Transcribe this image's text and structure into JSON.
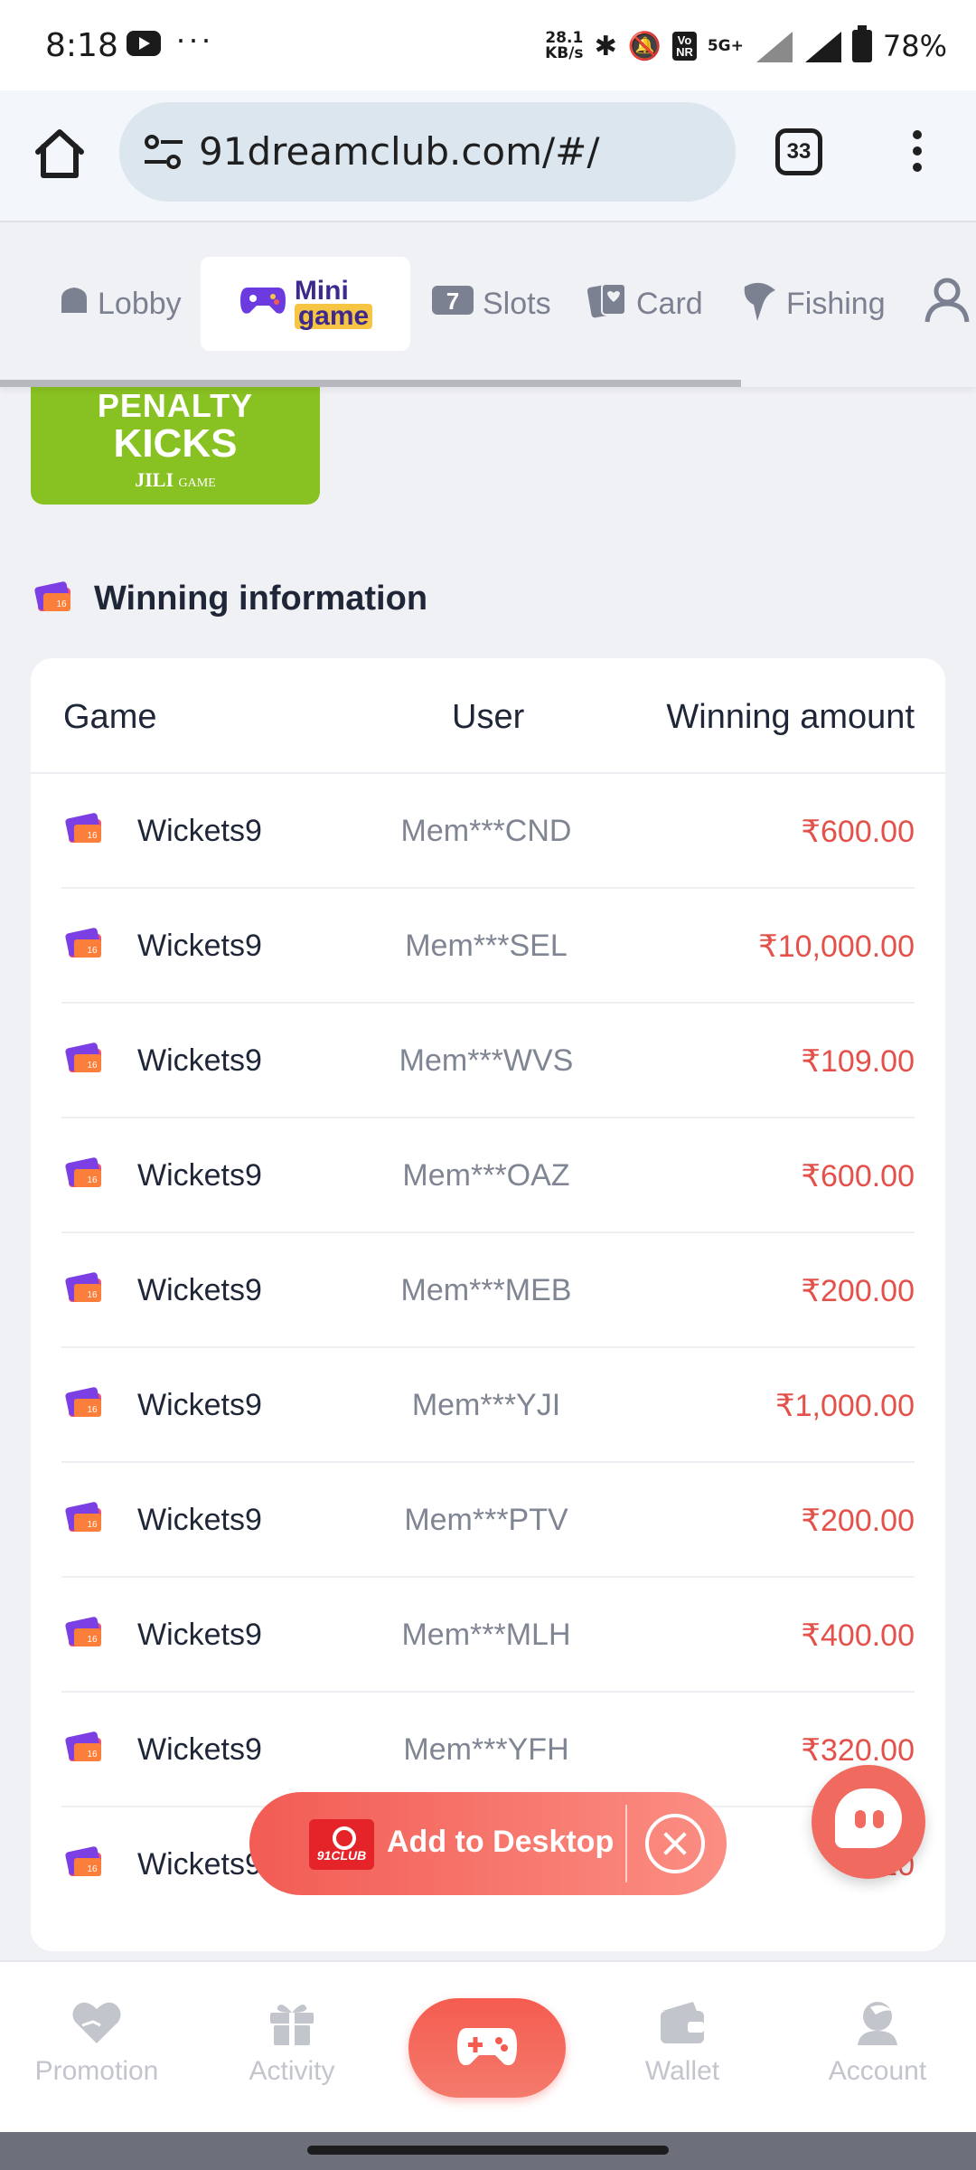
{
  "status_bar": {
    "time": "8:18",
    "dots": "···",
    "speed_top": "28.1",
    "speed_bottom": "KB/s",
    "volte_top": "Vo",
    "volte_bottom": "NR",
    "network": "5G+",
    "battery": "78%"
  },
  "browser": {
    "url": "91dreamclub.com/#/",
    "tab_count": "33"
  },
  "categories": [
    {
      "label": "Lobby"
    },
    {
      "label_line1": "Mini",
      "label_line2": "game"
    },
    {
      "label": "Slots"
    },
    {
      "label": "Card"
    },
    {
      "label": "Fishing"
    }
  ],
  "penalty_tile": {
    "line1": "PENALTY",
    "line2": "KICKS",
    "brand": "JILI",
    "brand_suffix": "GAME"
  },
  "winning": {
    "title": "Winning information",
    "columns": {
      "game": "Game",
      "user": "User",
      "amount": "Winning amount"
    },
    "rows": [
      {
        "game": "Wickets9",
        "user": "Mem***CND",
        "amount": "₹600.00"
      },
      {
        "game": "Wickets9",
        "user": "Mem***SEL",
        "amount": "₹10,000.00"
      },
      {
        "game": "Wickets9",
        "user": "Mem***WVS",
        "amount": "₹109.00"
      },
      {
        "game": "Wickets9",
        "user": "Mem***OAZ",
        "amount": "₹600.00"
      },
      {
        "game": "Wickets9",
        "user": "Mem***MEB",
        "amount": "₹200.00"
      },
      {
        "game": "Wickets9",
        "user": "Mem***YJI",
        "amount": "₹1,000.00"
      },
      {
        "game": "Wickets9",
        "user": "Mem***PTV",
        "amount": "₹200.00"
      },
      {
        "game": "Wickets9",
        "user": "Mem***MLH",
        "amount": "₹400.00"
      },
      {
        "game": "Wickets9",
        "user": "Mem***YFH",
        "amount": "₹320.00"
      },
      {
        "game": "Wickets9",
        "user": "",
        "amount": "₹10"
      }
    ]
  },
  "add_to_desktop": {
    "logo_text": "91CLUB",
    "label": "Add to Desktop"
  },
  "bottom_nav": {
    "promotion": "Promotion",
    "activity": "Activity",
    "wallet": "Wallet",
    "account": "Account"
  },
  "colors": {
    "accent": "#f25c54",
    "amount": "#e4514a",
    "penalty_green": "#88c122"
  }
}
